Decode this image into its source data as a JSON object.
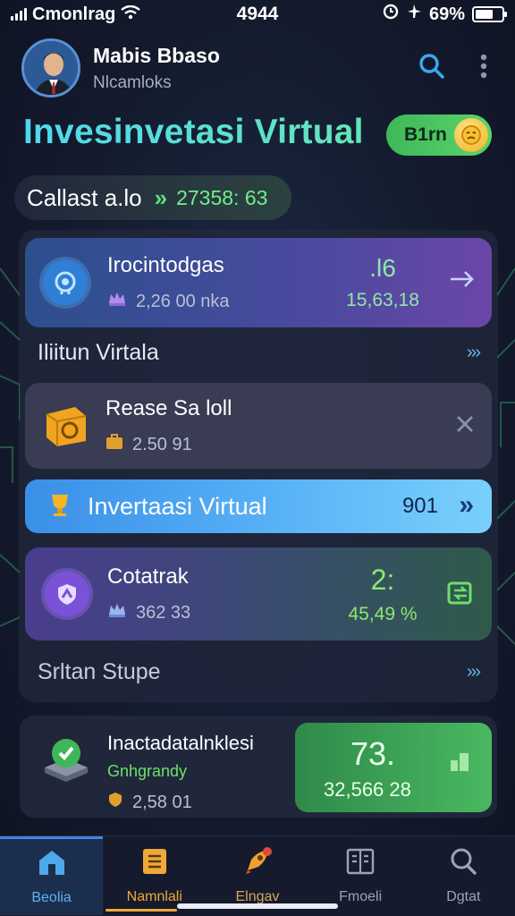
{
  "status_bar": {
    "carrier": "Cmonlrag",
    "time": "4944",
    "battery": "69%",
    "battery_level": 0.69
  },
  "header": {
    "user_name": "Mabis Bbaso",
    "user_sub": "Nlcamloks",
    "icons": [
      "search-icon",
      "more-vertical-icon"
    ]
  },
  "title": "Invesinvetasi Virtual",
  "coin_pill": {
    "label": "B1rn",
    "icon": "coin-icon"
  },
  "balance": {
    "label": "Callast a.lo",
    "value": "27358: 63"
  },
  "cards": [
    {
      "title": "Irocintodgas",
      "sub": "2,26 00 nka",
      "right_top": ".l6",
      "right_bottom": "15,63,18",
      "action": "arrow-right-icon"
    },
    {
      "title": "Rease Sa loll",
      "sub": "2.50 91",
      "action": "close-icon"
    },
    {
      "title": "Cotatrak",
      "sub": "362 33",
      "right_top": "2:",
      "right_bottom": "45,49 %",
      "action": "exchange-icon"
    }
  ],
  "section1": {
    "label": "Iliitun Virtala",
    "chevron": "›››"
  },
  "banner": {
    "label": "Invertaasi Virtual",
    "value": "901",
    "chevron": "»"
  },
  "section2": {
    "label": "Srltan Stupe",
    "chevron": "›››"
  },
  "bottom_card": {
    "title": "Inactadatalnklesi",
    "sub_green": "Gnhgrandy",
    "sub": "2,58 01",
    "value_big": "73.",
    "value": "32,566 28"
  },
  "nav": [
    {
      "label": "Beolia",
      "icon": "home-icon"
    },
    {
      "label": "Namnlali",
      "icon": "document-icon"
    },
    {
      "label": "Elngav",
      "icon": "rocket-icon"
    },
    {
      "label": "Fmoeli",
      "icon": "book-icon"
    },
    {
      "label": "Dgtat",
      "icon": "search-icon"
    }
  ],
  "colors": {
    "accent_blue": "#3d86e6",
    "accent_green": "#49b860",
    "title_cyan": "#4fd8f0",
    "orange": "#f0a838"
  }
}
